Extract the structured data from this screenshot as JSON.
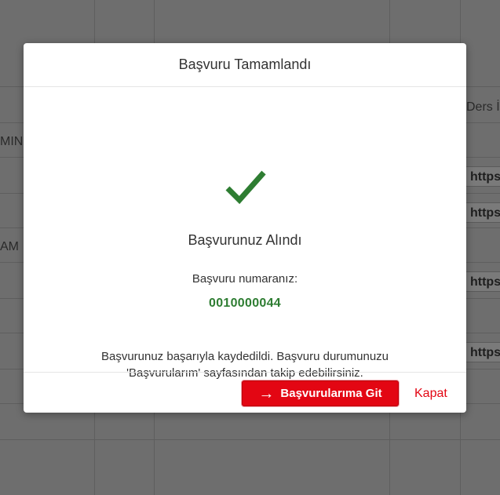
{
  "background": {
    "header_text": "Ders İ",
    "row_labels": [
      "MIN",
      "AM"
    ],
    "link_texts": [
      "https",
      "https",
      "https",
      "https"
    ]
  },
  "modal": {
    "title": "Başvuru Tamamlandı",
    "icon": "check-icon",
    "received_text": "Başvurunuz Alındı",
    "number_label": "Başvuru numaranız:",
    "number_value": "0010000044",
    "message_line1": "Başvurunuz başarıyla kaydedildi. Başvuru durumunuzu",
    "message_line2": "'Başvurularım' sayfasından takip edebilirsiniz.",
    "primary_button": "Başvurularıma Git",
    "close_label": "Kapat"
  },
  "colors": {
    "accent": "#e30613",
    "success": "#2e7d32"
  }
}
